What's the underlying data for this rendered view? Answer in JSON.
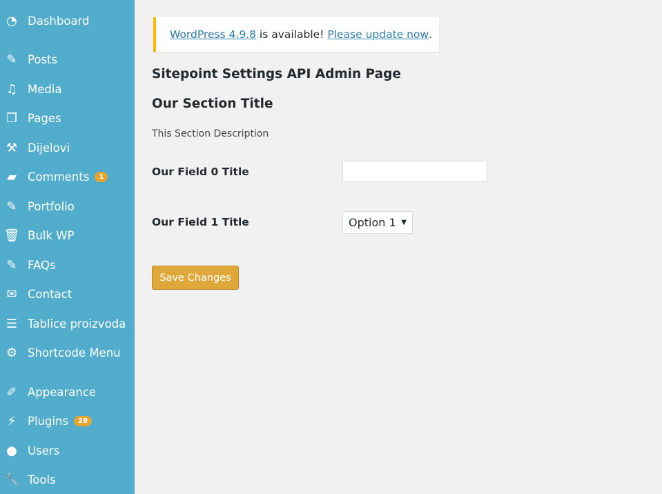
{
  "sidebar": {
    "items": [
      {
        "label": "Dashboard",
        "icon": "dashboard-icon",
        "glyph": "◔"
      },
      {
        "label": "Posts",
        "icon": "pin-icon",
        "glyph": "✎"
      },
      {
        "label": "Media",
        "icon": "media-icon",
        "glyph": "♫"
      },
      {
        "label": "Pages",
        "icon": "pages-icon",
        "glyph": "❐"
      },
      {
        "label": "Dijelovi",
        "icon": "hammer-icon",
        "glyph": "⚒"
      },
      {
        "label": "Comments",
        "icon": "comment-icon",
        "glyph": "▰",
        "badge": "1"
      },
      {
        "label": "Portfolio",
        "icon": "pin-icon",
        "glyph": "✎"
      },
      {
        "label": "Bulk WP",
        "icon": "trash-icon",
        "glyph": "🗑"
      },
      {
        "label": "FAQs",
        "icon": "pin-icon",
        "glyph": "✎"
      },
      {
        "label": "Contact",
        "icon": "email-icon",
        "glyph": "✉"
      },
      {
        "label": "Tablice proizvoda",
        "icon": "list-icon",
        "glyph": "☰"
      },
      {
        "label": "Shortcode Menu",
        "icon": "gear-icon",
        "glyph": "⚙"
      },
      {
        "label": "Appearance",
        "icon": "brush-icon",
        "glyph": "✐"
      },
      {
        "label": "Plugins",
        "icon": "plugin-icon",
        "glyph": "⚡",
        "badge": "28"
      },
      {
        "label": "Users",
        "icon": "user-icon",
        "glyph": "●"
      },
      {
        "label": "Tools",
        "icon": "wrench-icon",
        "glyph": "🔧"
      }
    ]
  },
  "notice": {
    "link1": "WordPress 4.9.8",
    "middle": " is available! ",
    "link2": "Please update now",
    "end": "."
  },
  "page_title": "Sitepoint Settings API Admin Page",
  "section": {
    "title": "Our Section Title",
    "description": "This Section Description"
  },
  "fields": [
    {
      "label": "Our Field 0 Title",
      "value": ""
    },
    {
      "label": "Our Field 1 Title",
      "value": "Option 1"
    }
  ],
  "save_label": "Save Changes",
  "colors": {
    "sidebar": "#52accc",
    "accent": "#e0a83a",
    "notice_border": "#ffb900",
    "link": "#2a7ea9"
  }
}
